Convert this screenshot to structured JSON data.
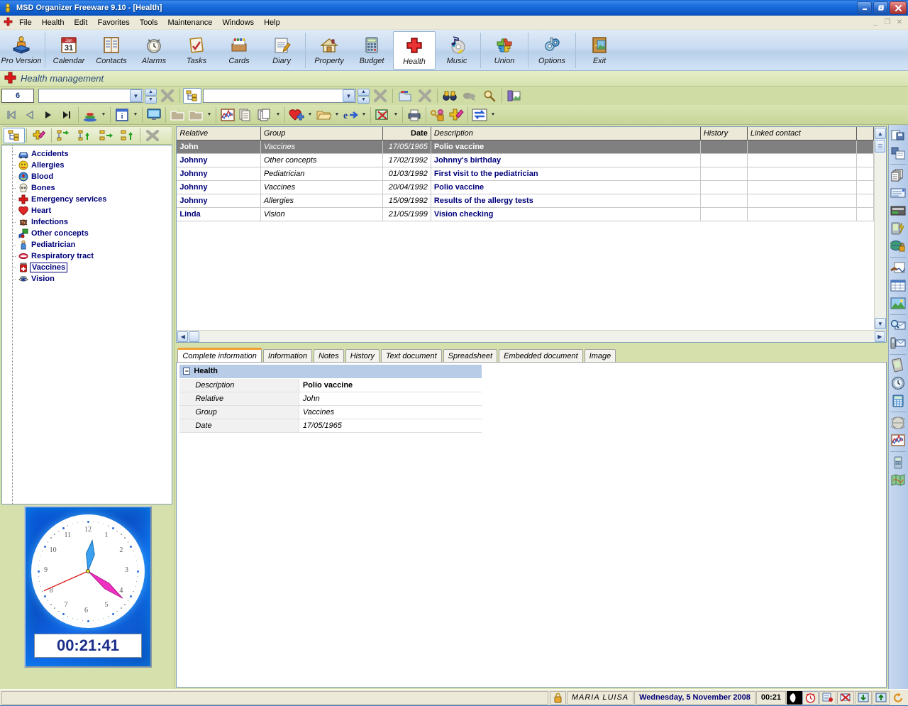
{
  "window": {
    "title": "MSD Organizer Freeware 9.10 - [Health]",
    "icon": "app-icon",
    "buttons": {
      "minimize": "_",
      "restore": "❐",
      "close": "✕"
    },
    "mdi_buttons": {
      "minimize": "_",
      "restore": "❐",
      "close": "✕"
    }
  },
  "menubar": {
    "icon": "health-cross-icon",
    "items": [
      "File",
      "Health",
      "Edit",
      "Favorites",
      "Tools",
      "Maintenance",
      "Windows",
      "Help"
    ]
  },
  "toolbar": {
    "items": [
      {
        "label": "Pro Version",
        "icon": "pro-version-icon",
        "selected": false
      },
      {
        "label": "Calendar",
        "icon": "calendar-icon",
        "selected": false
      },
      {
        "label": "Contacts",
        "icon": "contacts-icon",
        "selected": false
      },
      {
        "label": "Alarms",
        "icon": "alarm-clock-icon",
        "selected": false
      },
      {
        "label": "Tasks",
        "icon": "tasks-clipboard-icon",
        "selected": false
      },
      {
        "label": "Cards",
        "icon": "cards-box-icon",
        "selected": false
      },
      {
        "label": "Diary",
        "icon": "diary-notepad-icon",
        "selected": false
      },
      {
        "label": "Property",
        "icon": "property-house-icon",
        "selected": false
      },
      {
        "label": "Budget",
        "icon": "budget-calculator-icon",
        "selected": false
      },
      {
        "label": "Health",
        "icon": "health-cross-icon",
        "selected": true
      },
      {
        "label": "Music",
        "icon": "music-cd-icon",
        "selected": false
      },
      {
        "label": "Union",
        "icon": "union-puzzle-icon",
        "selected": false
      },
      {
        "label": "Options",
        "icon": "options-gear-icon",
        "selected": false
      },
      {
        "label": "Exit",
        "icon": "exit-door-icon",
        "selected": false
      }
    ]
  },
  "module_header": {
    "icon": "health-cross-icon",
    "title": "Health management"
  },
  "filterbar": {
    "record_count": "6",
    "search_value": "",
    "search_placeholder": "",
    "filter_value": "",
    "filter_placeholder": "",
    "icons": [
      "tree-view-icon",
      "clear-filter-icon",
      "folder-filter-icon",
      "clear-search-icon",
      "binoculars-search-icon",
      "cloud-search-icon",
      "magnifier-icon",
      "open-window-icon"
    ]
  },
  "navbar": {
    "icons": [
      "first-record-icon",
      "previous-record-icon",
      "next-record-icon",
      "last-record-icon",
      "stack-levels-icon",
      "info-icon",
      "monitor-preview-icon",
      "folder-icon",
      "folder-open-icon",
      "chart-icon",
      "copy-records-icon",
      "add-health-record-icon",
      "open-folder-icon",
      "send-email-icon",
      "delete-record-icon",
      "print-icon",
      "permissions-icon",
      "health-edit-icon",
      "exchange-icon"
    ]
  },
  "tree_panel": {
    "toolbar_icons": [
      "tree-view-icon",
      "edit-group-icon",
      "add-group-icon",
      "add-subgroup-icon",
      "move-group-icon",
      "promote-group-icon",
      "delete-group-icon"
    ],
    "items": [
      {
        "label": "Accidents",
        "icon": "accident-car-icon",
        "selected": false
      },
      {
        "label": "Allergies",
        "icon": "allergy-icon",
        "selected": false
      },
      {
        "label": "Blood",
        "icon": "blood-icon",
        "selected": false
      },
      {
        "label": "Bones",
        "icon": "bones-skull-icon",
        "selected": false
      },
      {
        "label": "Emergency services",
        "icon": "emergency-cross-icon",
        "selected": false
      },
      {
        "label": "Heart",
        "icon": "heart-icon",
        "selected": false
      },
      {
        "label": "Infections",
        "icon": "infection-icon",
        "selected": false
      },
      {
        "label": "Other concepts",
        "icon": "other-concepts-icon",
        "selected": false
      },
      {
        "label": "Pediatrician",
        "icon": "pediatrician-icon",
        "selected": false
      },
      {
        "label": "Respiratory tract",
        "icon": "respiratory-mouth-icon",
        "selected": false
      },
      {
        "label": "Vaccines",
        "icon": "vaccine-bottle-icon",
        "selected": true
      },
      {
        "label": "Vision",
        "icon": "vision-eye-icon",
        "selected": false
      }
    ]
  },
  "clock": {
    "digital_time": "00:21:41",
    "hour_numbers": [
      "12",
      "1",
      "2",
      "3",
      "4",
      "5",
      "6",
      "7",
      "8",
      "9",
      "10",
      "11"
    ],
    "hour_angle_deg": 8,
    "minute_angle_deg": 128,
    "second_angle_deg": 246
  },
  "grid": {
    "columns": [
      "Relative",
      "Group",
      "Date",
      "Description",
      "History",
      "Linked contact"
    ],
    "rows": [
      {
        "relative": "John",
        "group": "Vaccines",
        "date": "17/05/1965",
        "description": "Polio vaccine",
        "history": "",
        "linked_contact": "",
        "selected": true
      },
      {
        "relative": "Johnny",
        "group": "Other concepts",
        "date": "17/02/1992",
        "description": "Johnny's birthday",
        "history": "",
        "linked_contact": "",
        "selected": false
      },
      {
        "relative": "Johnny",
        "group": "Pediatrician",
        "date": "01/03/1992",
        "description": "First visit to the pediatrician",
        "history": "",
        "linked_contact": "",
        "selected": false
      },
      {
        "relative": "Johnny",
        "group": "Vaccines",
        "date": "20/04/1992",
        "description": "Polio vaccine",
        "history": "",
        "linked_contact": "",
        "selected": false
      },
      {
        "relative": "Johnny",
        "group": "Allergies",
        "date": "15/09/1992",
        "description": "Results of the allergy tests",
        "history": "",
        "linked_contact": "",
        "selected": false
      },
      {
        "relative": "Linda",
        "group": "Vision",
        "date": "21/05/1999",
        "description": "Vision checking",
        "history": "",
        "linked_contact": "",
        "selected": false
      }
    ]
  },
  "tabs": [
    {
      "label": "Complete information",
      "active": true
    },
    {
      "label": "Information",
      "active": false
    },
    {
      "label": "Notes",
      "active": false
    },
    {
      "label": "History",
      "active": false
    },
    {
      "label": "Text document",
      "active": false
    },
    {
      "label": "Spreadsheet",
      "active": false
    },
    {
      "label": "Embedded document",
      "active": false
    },
    {
      "label": "Image",
      "active": false
    }
  ],
  "detail": {
    "group_title": "Health",
    "collapse_glyph": "−",
    "fields": [
      {
        "label": "Description",
        "value": "Polio vaccine",
        "style": "bold"
      },
      {
        "label": "Relative",
        "value": "John",
        "style": "ital"
      },
      {
        "label": "Group",
        "value": "Vaccines",
        "style": "ital"
      },
      {
        "label": "Date",
        "value": "17/05/1965",
        "style": "ital"
      }
    ]
  },
  "right_strip": {
    "icons": [
      "save-document-icon",
      "copy-document-icon",
      "multi-documents-icon",
      "envelope-icon",
      "card-icon",
      "pda-sync-icon",
      "globe-lock-icon",
      "signature-icon",
      "spreadsheet-icon",
      "image-icon",
      "search-mail-icon",
      "mobile-mail-icon",
      "pda-icon",
      "clock-icon",
      "calculator-icon",
      "world-icon",
      "chart-icon",
      "calculator-small-icon",
      "map-icon"
    ]
  },
  "statusbar": {
    "lock_icon": "lock-icon",
    "user": "MARIA  LUISA",
    "date": "Wednesday, 5 November 2008",
    "time": "00:21",
    "moon_icon": "moon-phase-icon",
    "icons": [
      "alarm-clock-icon",
      "note-icon",
      "no-mail-icon",
      "download-icon",
      "upload-icon",
      "refresh-icon"
    ]
  }
}
